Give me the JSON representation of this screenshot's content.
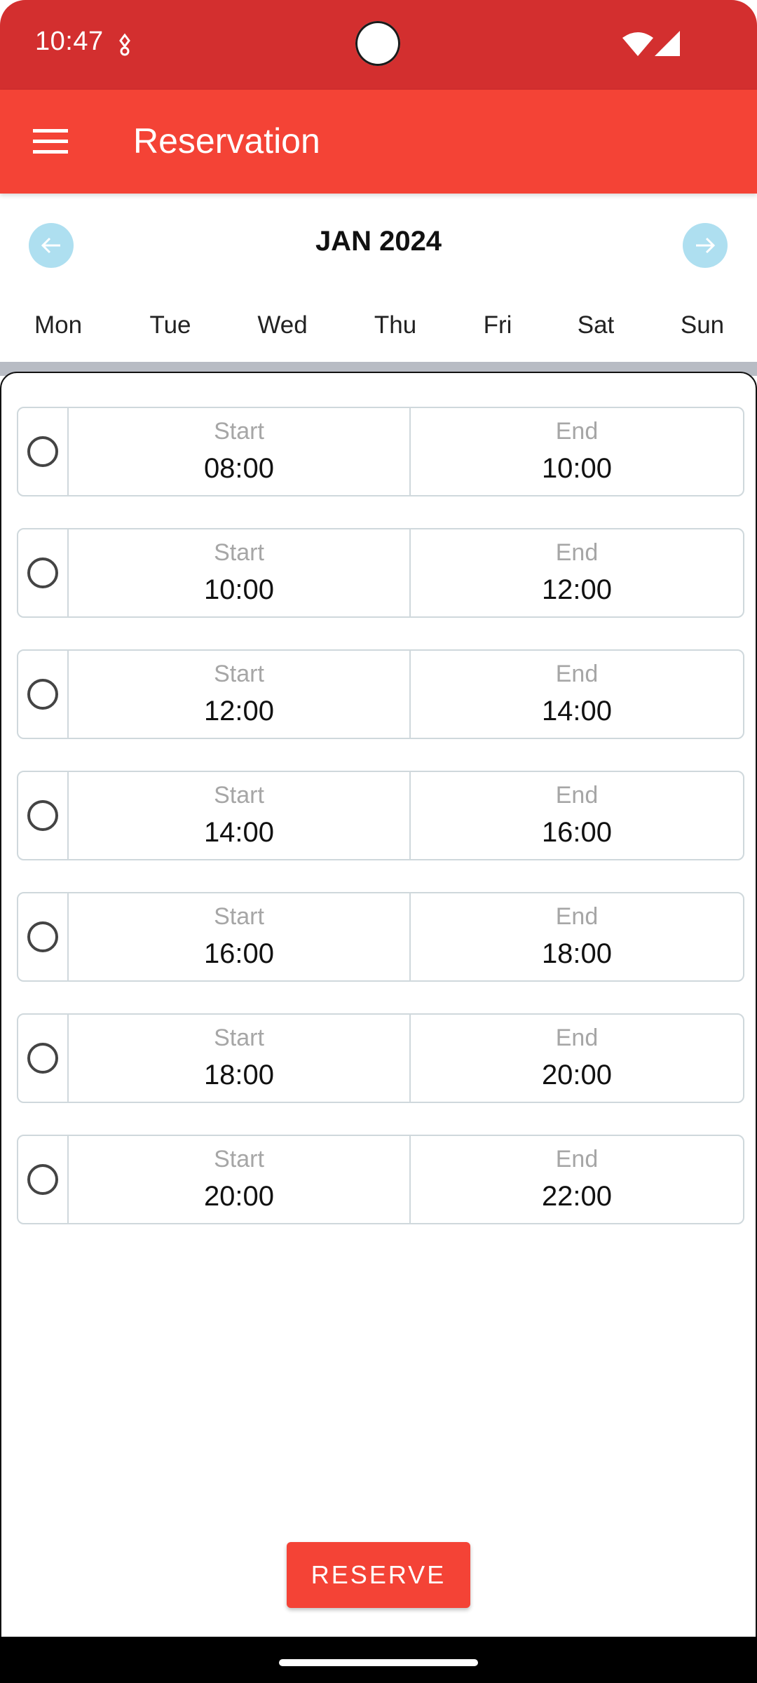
{
  "status_bar": {
    "time": "10:47"
  },
  "app_bar": {
    "title": "Reservation"
  },
  "calendar": {
    "month_label": "JAN 2024",
    "weekdays": [
      "Mon",
      "Tue",
      "Wed",
      "Thu",
      "Fri",
      "Sat",
      "Sun"
    ]
  },
  "slots": [
    {
      "start_label": "Start",
      "start": "08:00",
      "end_label": "End",
      "end": "10:00"
    },
    {
      "start_label": "Start",
      "start": "10:00",
      "end_label": "End",
      "end": "12:00"
    },
    {
      "start_label": "Start",
      "start": "12:00",
      "end_label": "End",
      "end": "14:00"
    },
    {
      "start_label": "Start",
      "start": "14:00",
      "end_label": "End",
      "end": "16:00"
    },
    {
      "start_label": "Start",
      "start": "16:00",
      "end_label": "End",
      "end": "18:00"
    },
    {
      "start_label": "Start",
      "start": "18:00",
      "end_label": "End",
      "end": "20:00"
    },
    {
      "start_label": "Start",
      "start": "20:00",
      "end_label": "End",
      "end": "22:00"
    }
  ],
  "actions": {
    "reserve_label": "RESERVE"
  },
  "icons": {
    "menu": "hamburger-menu-icon",
    "prev_month": "arrow-left-icon",
    "next_month": "arrow-right-icon",
    "wifi": "wifi-icon",
    "signal": "cell-signal-icon"
  },
  "colors": {
    "status_bar": "#d32f2f",
    "app_bar": "#f44336",
    "nav_circle": "#aedff0",
    "reserve_button": "#f44336"
  }
}
